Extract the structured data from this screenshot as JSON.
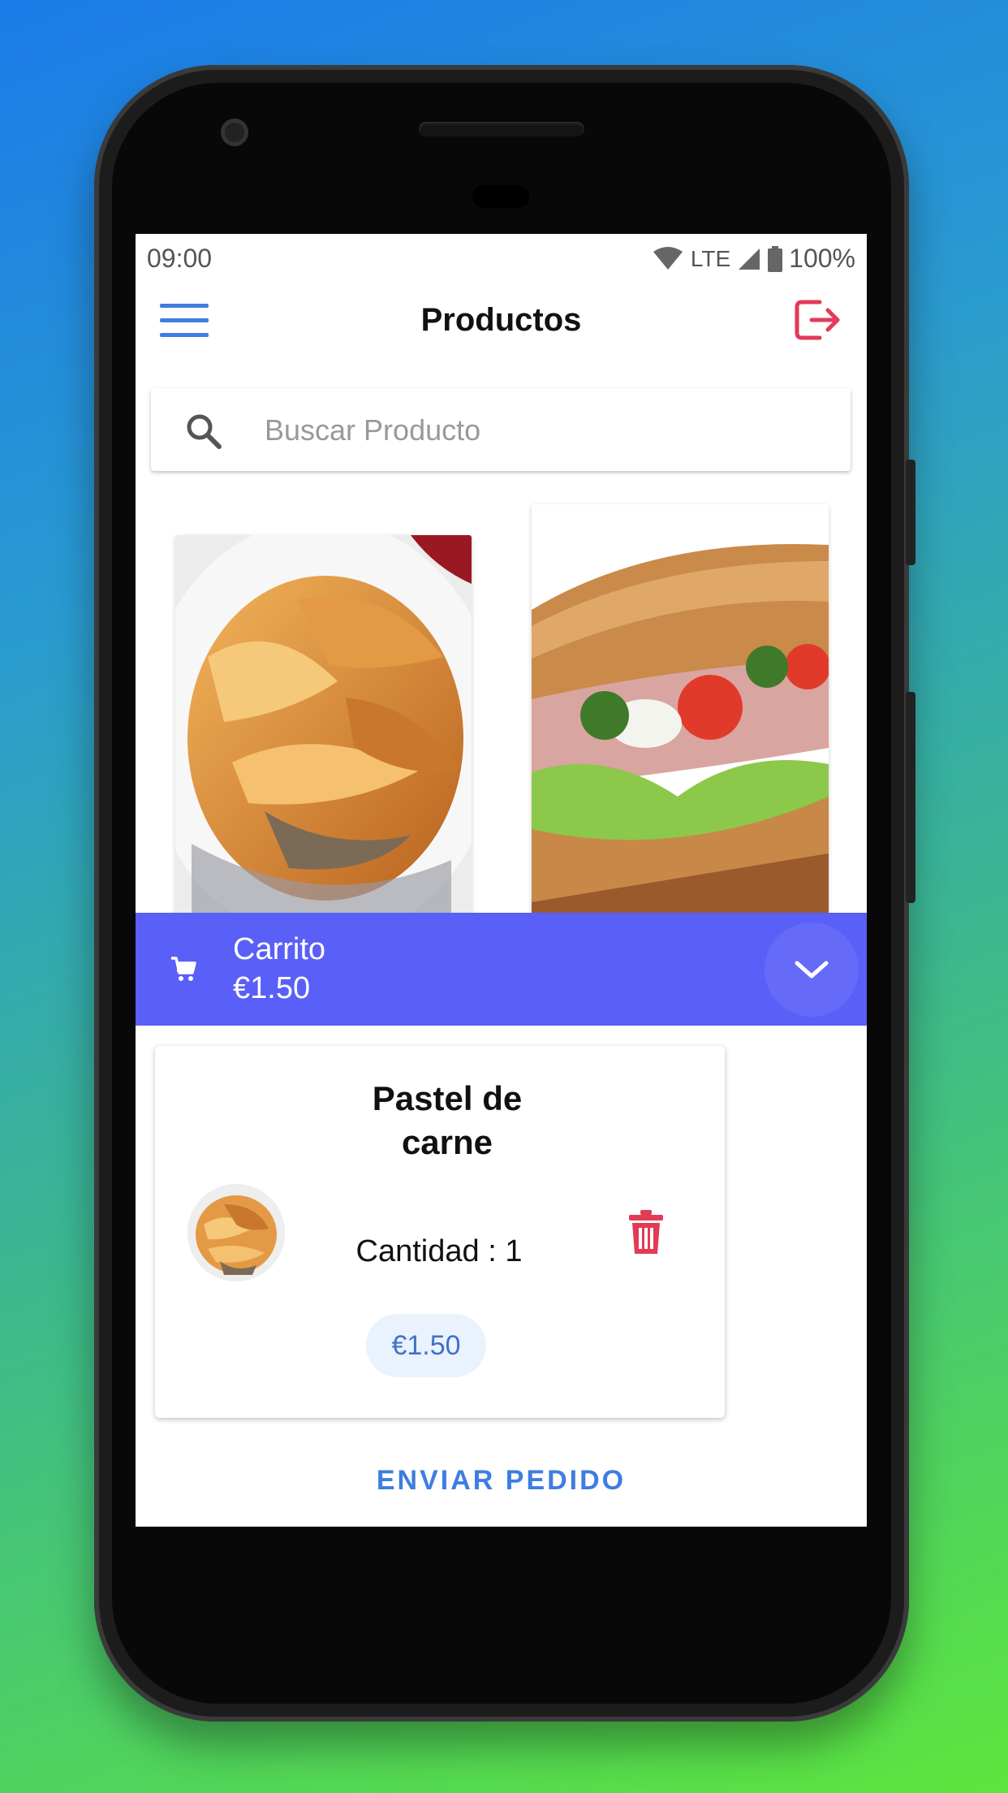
{
  "status_bar": {
    "time": "09:00",
    "network": "LTE",
    "battery": "100%"
  },
  "app_bar": {
    "title": "Productos"
  },
  "search": {
    "placeholder": "Buscar Producto"
  },
  "products": [
    {
      "image": "meat-pastry-photo"
    },
    {
      "image": "tuna-sandwich-photo"
    }
  ],
  "cart": {
    "label": "Carrito",
    "total": "€1.50",
    "items": [
      {
        "name": "Pastel de carne",
        "quantity_text": "Cantidad : 1",
        "price": "€1.50"
      }
    ],
    "submit_label": "ENVIAR PEDIDO"
  },
  "colors": {
    "accent": "#3f7de0",
    "cart_bar": "#5a5ff8",
    "danger": "#e23b56",
    "price_pill": "#eaf2fd"
  }
}
